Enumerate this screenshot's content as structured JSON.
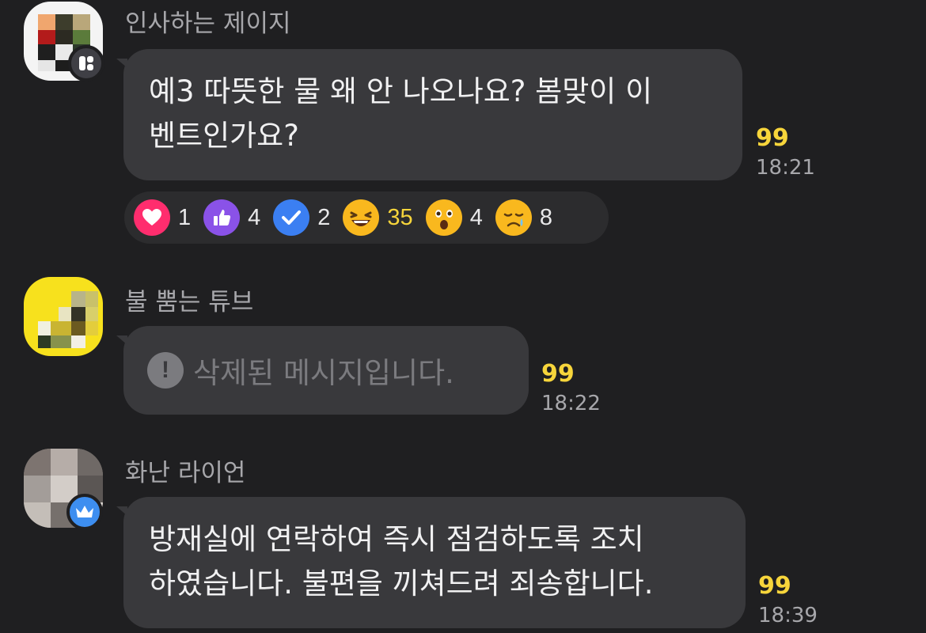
{
  "messages": [
    {
      "sender": "인사하는 제이지",
      "lines": [
        "예3 따뜻한 물 왜 안 나오나요? 봄맞이 이",
        "벤트인가요?"
      ],
      "unread_count": "99",
      "time": "18:21"
    },
    {
      "sender": "불 뿜는 튜브",
      "deleted_text": "삭제된 메시지입니다.",
      "unread_count": "99",
      "time": "18:22"
    },
    {
      "sender": "화난 라이언",
      "lines": [
        "방재실에 연락하여 즉시 점검하도록 조치",
        "하였습니다. 불편을 끼쳐드려 죄송합니다."
      ],
      "unread_count": "99",
      "time": "18:39"
    }
  ],
  "reactions": [
    {
      "icon": "heart-icon",
      "count": "1",
      "color": "#ff2d6e"
    },
    {
      "icon": "thumbs-up-icon",
      "count": "4",
      "color": "#8a52e8"
    },
    {
      "icon": "check-icon",
      "count": "2",
      "color": "#3b7ff2"
    },
    {
      "icon": "laughing-face-icon",
      "count": "35",
      "color": "#f9b81e",
      "highlighted": true
    },
    {
      "icon": "surprised-face-icon",
      "count": "4",
      "color": "#f9b81e"
    },
    {
      "icon": "sad-face-icon",
      "count": "8",
      "color": "#f9b81e"
    }
  ],
  "colors": {
    "background": "#1f1f21",
    "bubble": "#39393c",
    "unread_count": "#f7d53b",
    "muted_text": "#a7a7ab"
  }
}
